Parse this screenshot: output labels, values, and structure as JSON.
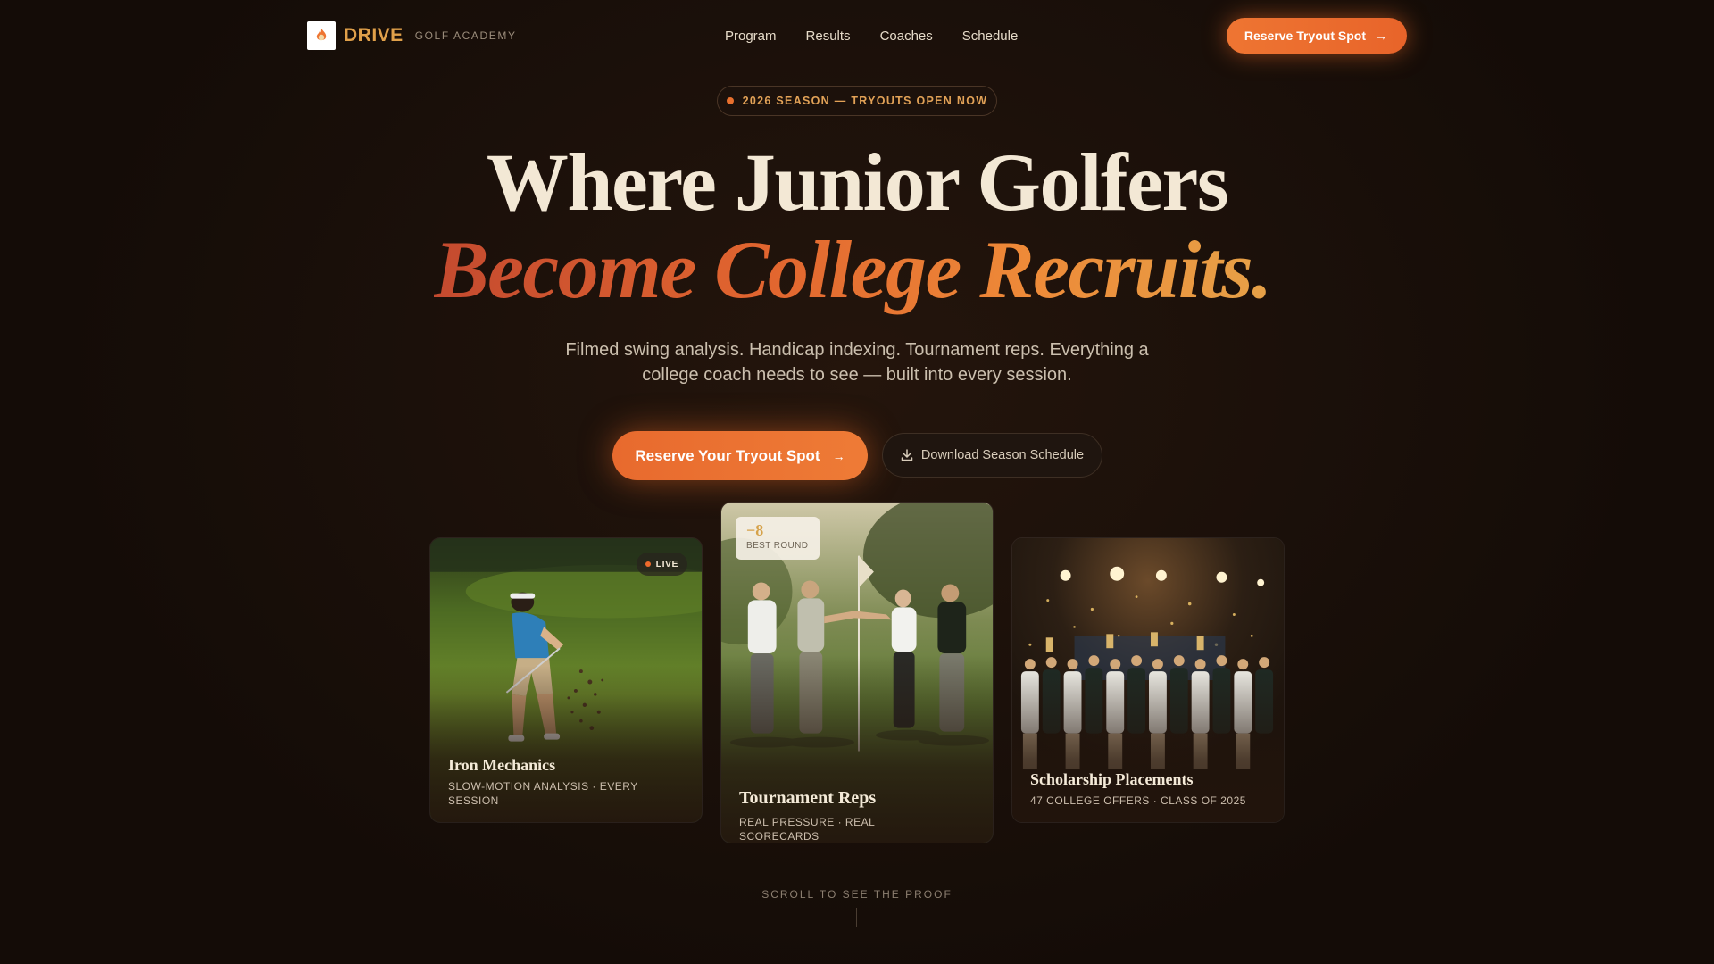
{
  "nav": {
    "brand_name": "DRIVE",
    "brand_sub": "GOLF ACADEMY",
    "links": [
      "Program",
      "Results",
      "Coaches",
      "Schedule"
    ],
    "cta_label": "Reserve Tryout Spot"
  },
  "hero": {
    "badge": "2026 SEASON — TRYOUTS OPEN NOW",
    "headline_line1": "Where Junior Golfers",
    "headline_line2": "Become College Recruits.",
    "subtitle": "Filmed swing analysis. Handicap indexing. Tournament reps. Everything a college coach needs to see — built into every session.",
    "primary_cta": "Reserve Your Tryout Spot",
    "secondary_cta": "Download Season Schedule"
  },
  "cards": [
    {
      "title": "Iron Mechanics",
      "meta": "SLOW-MOTION ANALYSIS · EVERY SESSION",
      "badge": "LIVE"
    },
    {
      "title": "Tournament Reps",
      "meta": "REAL PRESSURE · REAL SCORECARDS",
      "score": "−8",
      "score_label": "BEST ROUND"
    },
    {
      "title": "Scholarship Placements",
      "meta": "47 COLLEGE OFFERS · CLASS OF 2025"
    }
  ],
  "scroll_hint": "SCROLL TO SEE THE PROOF",
  "colors": {
    "accent": "#EE7532",
    "gold": "#E0A04A",
    "background": "#1B100A",
    "cream": "#F3E8D5"
  },
  "icons": {
    "logo": "golf-flame-logo-icon",
    "arrow": "arrow-right-icon",
    "download": "download-icon"
  }
}
